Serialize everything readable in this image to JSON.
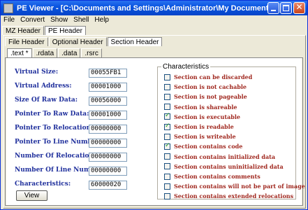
{
  "window": {
    "title": "PE Viewer   - [C:\\Documents and Settings\\Administrator\\My Documents\\Downloads\\put..."
  },
  "menubar": [
    "File",
    "Convert",
    "Show",
    "Shell",
    "Help"
  ],
  "tabs_row1": [
    "MZ Header",
    "PE Header"
  ],
  "tabs_row2": [
    "File Header",
    "Optional Header",
    "Section Header"
  ],
  "tabs_row3": [
    ".text *",
    ".rdata",
    ".data",
    ".rsrc"
  ],
  "fields": [
    {
      "label": "Virtual Size:",
      "value": "00055FB1"
    },
    {
      "label": "Virtual Address:",
      "value": "00001000"
    },
    {
      "label": "Size Of Raw Data:",
      "value": "00056000"
    },
    {
      "label": "Pointer To Raw Data:",
      "value": "00001000"
    },
    {
      "label": "Pointer To Relocations:",
      "value": "00000000"
    },
    {
      "label": "Pointer To Line Numbers:",
      "value": "00000000"
    },
    {
      "label": "Number Of Relocations:",
      "value": "00000000"
    },
    {
      "label": "Number Of Line Numbers:",
      "value": "00000000"
    },
    {
      "label": "Characteristics:",
      "value": "60000020"
    }
  ],
  "view_button": "View",
  "characteristics": {
    "title": "Characteristics",
    "items": [
      {
        "label": "Section can be discarded",
        "checked": false
      },
      {
        "label": "Section is not cachable",
        "checked": false
      },
      {
        "label": "Section is not pageable",
        "checked": false
      },
      {
        "label": "Section is shareable",
        "checked": false
      },
      {
        "label": "Section is executable",
        "checked": true
      },
      {
        "label": "Section is readable",
        "checked": true
      },
      {
        "label": "Section is writeable",
        "checked": false
      },
      {
        "label": "Section contains code",
        "checked": true
      },
      {
        "label": "Section contains initialized data",
        "checked": false
      },
      {
        "label": "Section contains uninitialized data",
        "checked": false
      },
      {
        "label": "Section contains comments",
        "checked": false
      },
      {
        "label": "Section contains will not be part of image",
        "checked": false
      },
      {
        "label": "Section contains extended relocations",
        "checked": false
      }
    ]
  }
}
